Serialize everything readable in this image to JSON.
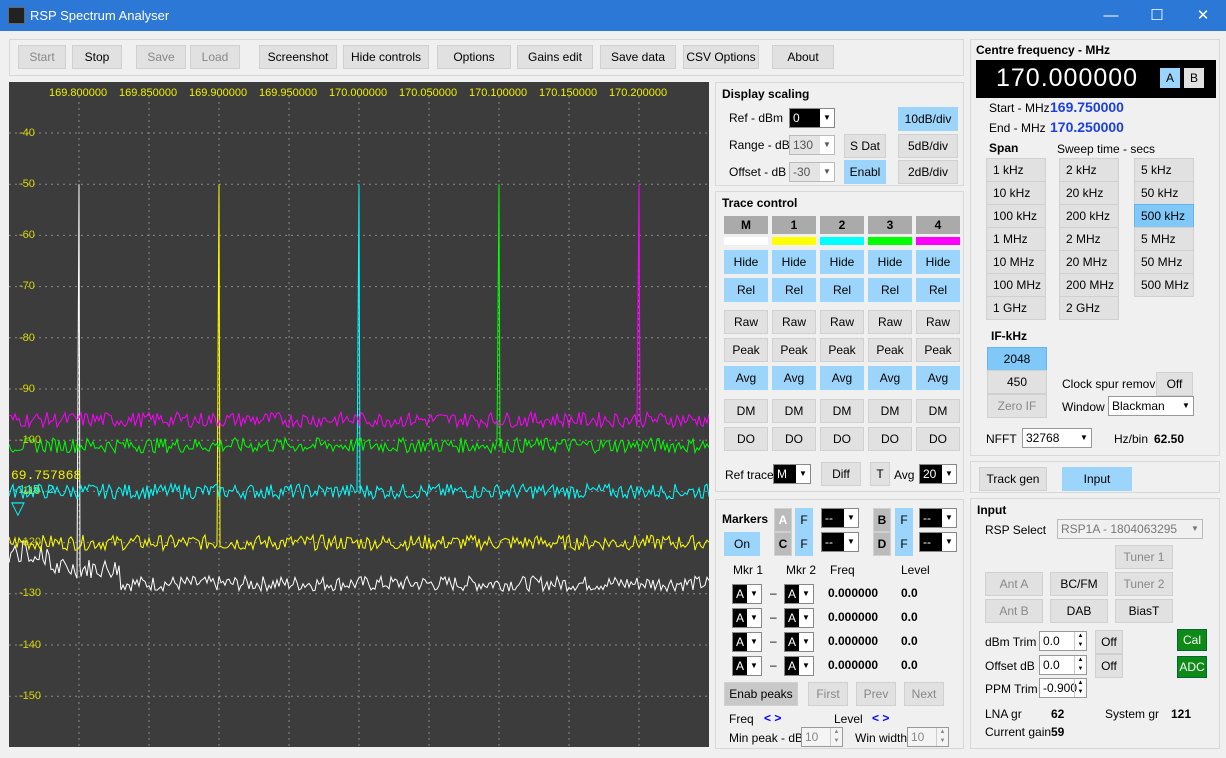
{
  "window": {
    "title": "RSP Spectrum Analyser",
    "minimize": "—",
    "maximize": "☐",
    "close": "✕"
  },
  "toolbar": {
    "start": "Start",
    "stop": "Stop",
    "save": "Save",
    "load": "Load",
    "screenshot": "Screenshot",
    "hide_controls": "Hide controls",
    "options": "Options",
    "gains_edit": "Gains edit",
    "save_data": "Save data",
    "csv_options": "CSV Options",
    "about": "About"
  },
  "plot": {
    "x_ticks": [
      "169.800000",
      "169.850000",
      "169.900000",
      "169.950000",
      "170.000000",
      "170.050000",
      "170.100000",
      "170.150000",
      "170.200000"
    ],
    "y_ticks": [
      "-40",
      "-50",
      "-60",
      "-70",
      "-80",
      "-90",
      "-100",
      "-110",
      "-120",
      "-130",
      "-140",
      "-150"
    ],
    "marker_readout": "69.757868",
    "marker_level": "-115.2",
    "colors": {
      "M": "#ffffff",
      "1": "#ffff00",
      "2": "#00ffff",
      "3": "#00ff00",
      "4": "#ff00ff"
    }
  },
  "chart_data": {
    "type": "line",
    "xlabel": "",
    "ylabel": "",
    "xlim": [
      169.75,
      170.25
    ],
    "ylim": [
      -155,
      -35
    ],
    "series": [
      {
        "color": "#ffffff",
        "floor": -128,
        "peak_x": 169.8,
        "peak_y": -50
      },
      {
        "color": "#ffff00",
        "floor": -120,
        "peak_x": 169.9,
        "peak_y": -50
      },
      {
        "color": "#00ffff",
        "floor": -110,
        "peak_x": 170.0,
        "peak_y": -50
      },
      {
        "color": "#00ff00",
        "floor": -101,
        "peak_x": 170.1,
        "peak_y": -50
      },
      {
        "color": "#ff00ff",
        "floor": -96,
        "peak_x": 170.2,
        "peak_y": -50
      }
    ]
  },
  "display_scaling": {
    "title": "Display scaling",
    "ref_label": "Ref - dBm",
    "ref_value": "0",
    "range_label": "Range - dB",
    "range_value": "130",
    "offset_label": "Offset - dB",
    "offset_value": "-30",
    "sdat": "S Dat",
    "enabl": "Enabl",
    "div10": "10dB/div",
    "div5": "5dB/div",
    "div2": "2dB/div"
  },
  "trace_control": {
    "title": "Trace control",
    "traces": [
      "M",
      "1",
      "2",
      "3",
      "4"
    ],
    "hide": "Hide",
    "rel": "Rel",
    "raw": "Raw",
    "peak": "Peak",
    "avg": "Avg",
    "dm": "DM",
    "do": "DO",
    "ref_trace_label": "Ref trace",
    "ref_trace_value": "M",
    "diff": "Diff",
    "t": "T",
    "avg_label": "Avg",
    "avg_value": "20"
  },
  "markers": {
    "title": "Markers",
    "a": "A",
    "b": "B",
    "c": "C",
    "d": "D",
    "f": "F",
    "dash": "--",
    "on": "On",
    "mkr1": "Mkr 1",
    "mkr2": "Mkr 2",
    "freq": "Freq",
    "level": "Level",
    "rows": [
      {
        "m1": "A",
        "m2": "A",
        "freq": "0.000000",
        "level": "0.0"
      },
      {
        "m1": "A",
        "m2": "A",
        "freq": "0.000000",
        "level": "0.0"
      },
      {
        "m1": "A",
        "m2": "A",
        "freq": "0.000000",
        "level": "0.0"
      },
      {
        "m1": "A",
        "m2": "A",
        "freq": "0.000000",
        "level": "0.0"
      }
    ],
    "enab_peaks": "Enab peaks",
    "first": "First",
    "prev": "Prev",
    "next": "Next",
    "freq_nav": "Freq",
    "level_nav": "Level",
    "arrows": "< >",
    "min_peak_label": "Min peak - dB",
    "min_peak_value": "10",
    "win_width_label": "Win width",
    "win_width_value": "10"
  },
  "centre": {
    "title": "Centre frequency - MHz",
    "value": "170.000000",
    "a": "A",
    "b": "B",
    "start_label": "Start - MHz",
    "start_value": "169.750000",
    "end_label": "End - MHz",
    "end_value": "170.250000",
    "span_label": "Span",
    "sweep_label": "Sweep time - secs",
    "span_col1": [
      "1 kHz",
      "10 kHz",
      "100 kHz",
      "1 MHz",
      "10 MHz",
      "100 MHz",
      "1 GHz"
    ],
    "span_col2": [
      "2 kHz",
      "20 kHz",
      "200 kHz",
      "2 MHz",
      "20 MHz",
      "200 MHz",
      "2 GHz"
    ],
    "span_col3": [
      "5 kHz",
      "50 kHz",
      "500 kHz",
      "5 MHz",
      "50 MHz",
      "500 MHz"
    ],
    "if_label": "IF-kHz",
    "if_2048": "2048",
    "if_450": "450",
    "if_zero": "Zero IF",
    "clock_spur_label": "Clock spur removal",
    "clock_spur_value": "Off",
    "window_label": "Window",
    "window_value": "Blackman",
    "nfft_label": "NFFT",
    "nfft_value": "32768",
    "hzbin_label": "Hz/bin",
    "hzbin_value": "62.50"
  },
  "tabs": {
    "track_gen": "Track gen",
    "input": "Input"
  },
  "input": {
    "title": "Input",
    "rsp_select_label": "RSP Select",
    "rsp_select_value": "RSP1A - 1804063295",
    "tuner1": "Tuner 1",
    "tuner2": "Tuner 2",
    "ant_a": "Ant A",
    "ant_b": "Ant B",
    "bcfm": "BC/FM",
    "dab": "DAB",
    "biast": "BiasT",
    "dbm_trim_label": "dBm Trim",
    "dbm_trim_value": "0.0",
    "offset_db_label": "Offset dB",
    "offset_db_value": "0.0",
    "off": "Off",
    "ppm_trim_label": "PPM Trim",
    "ppm_trim_value": "-0.900",
    "cal": "Cal",
    "adc": "ADC",
    "lna_gr_label": "LNA gr",
    "lna_gr_value": "62",
    "system_gr_label": "System gr",
    "system_gr_value": "121",
    "current_gain_label": "Current gain",
    "current_gain_value": "59"
  }
}
